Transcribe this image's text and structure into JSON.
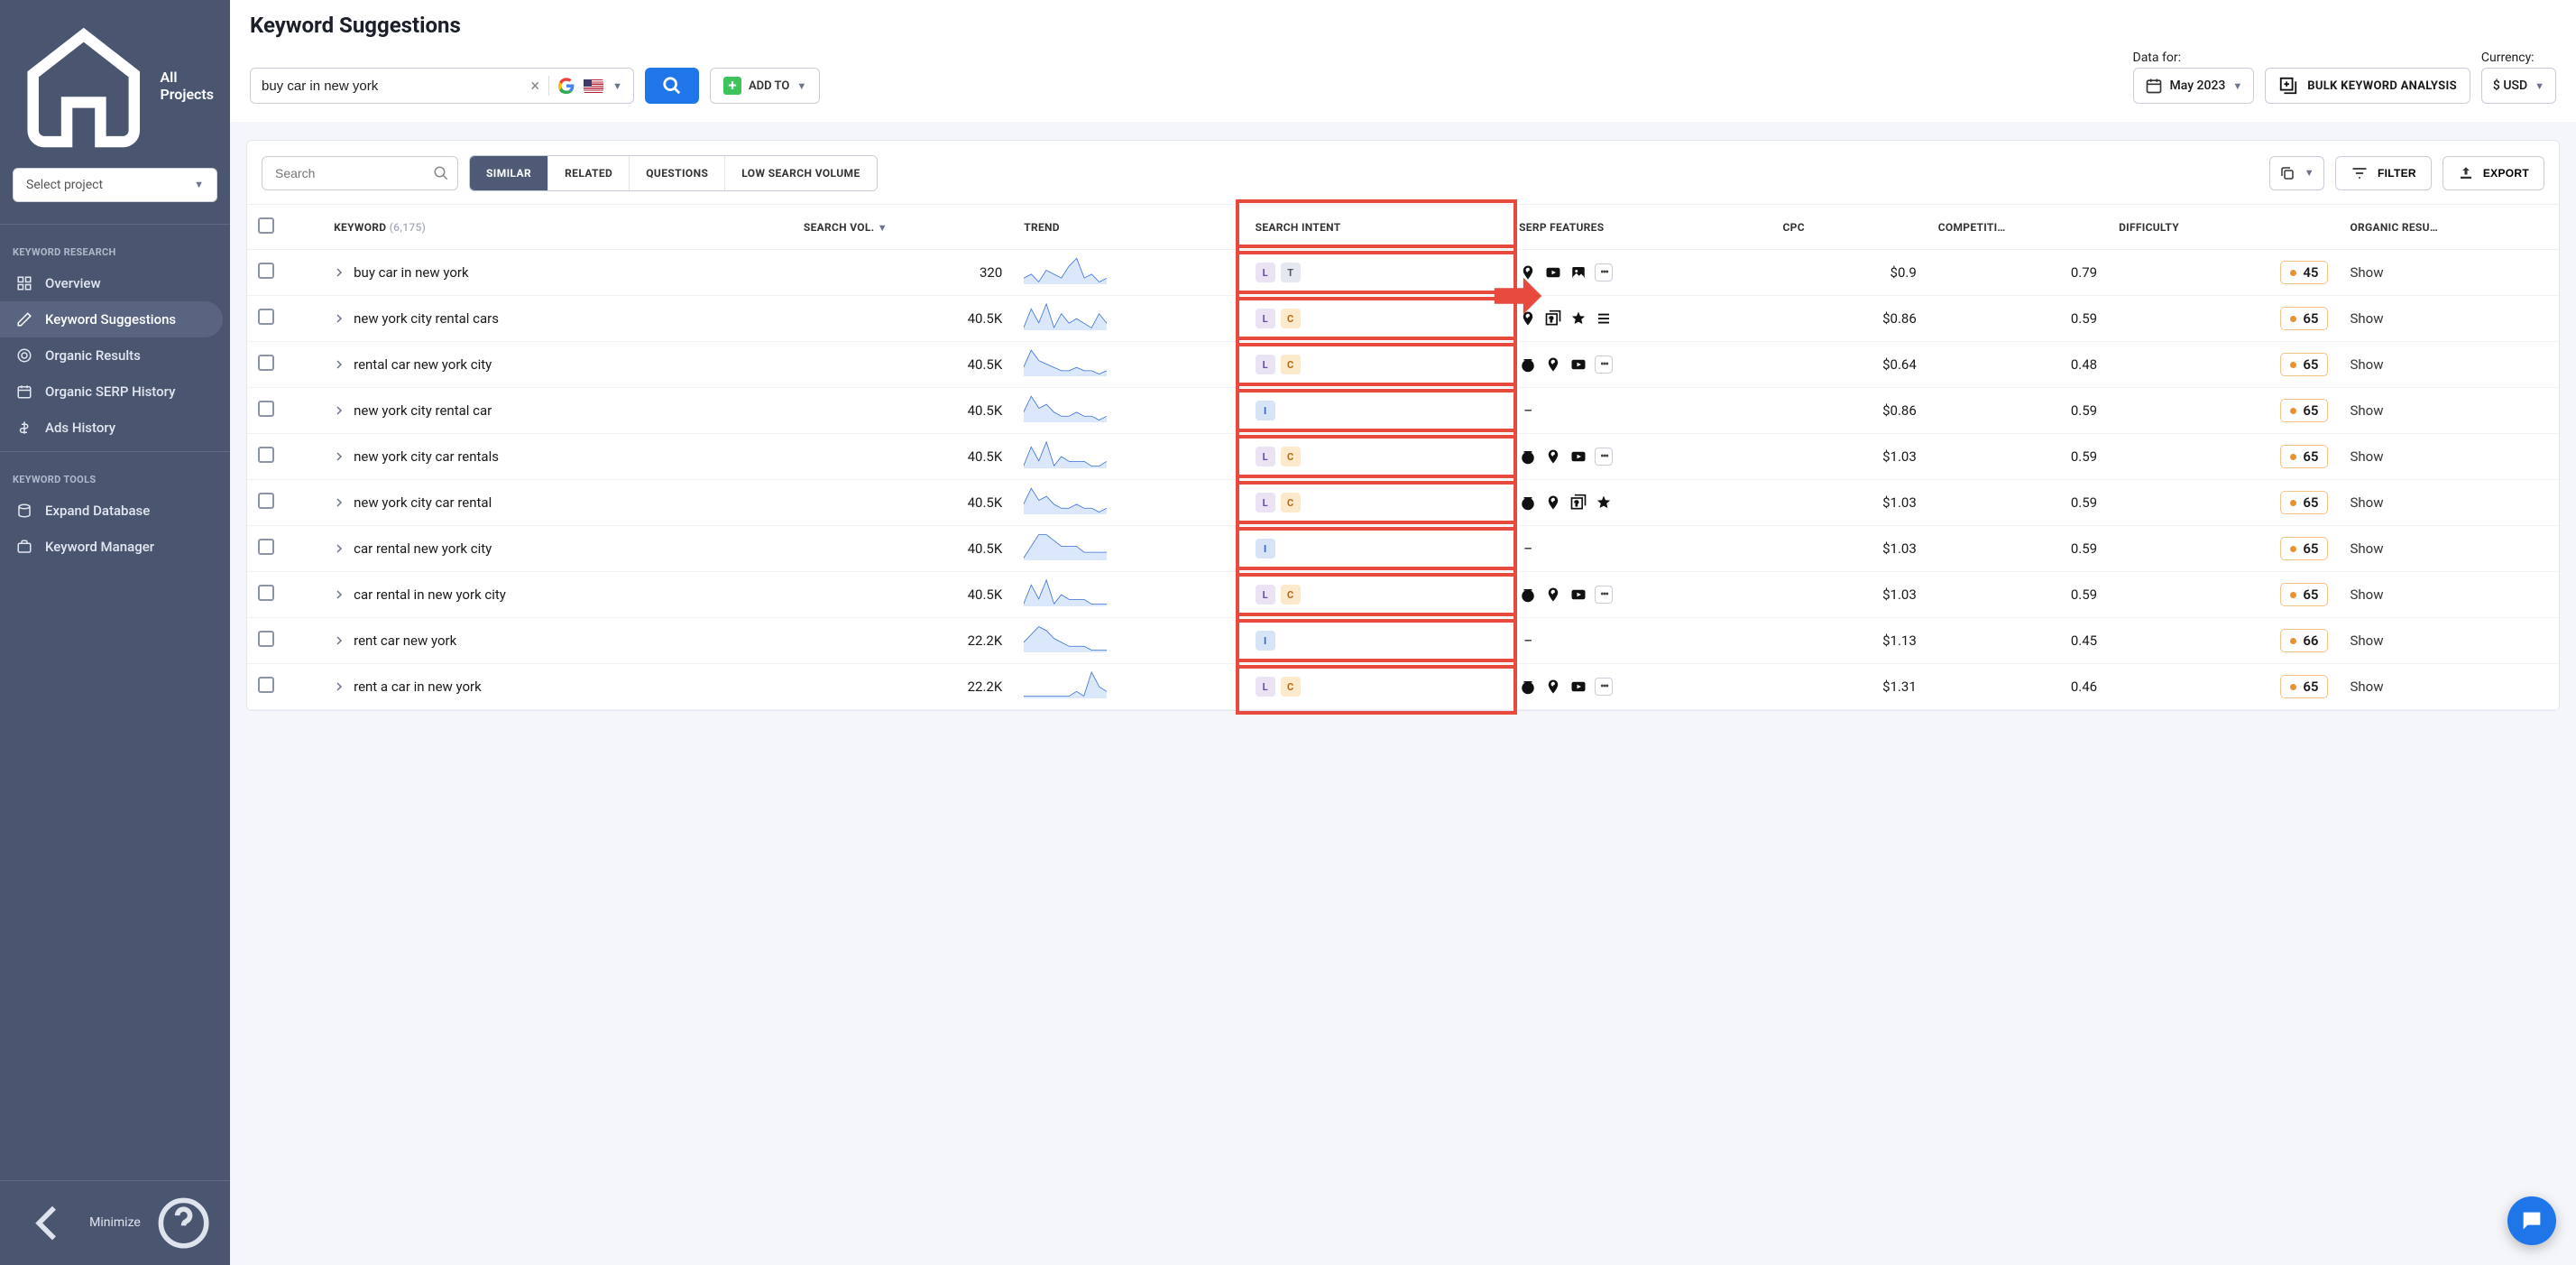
{
  "sidebar": {
    "all_projects": "All Projects",
    "select_project_placeholder": "Select project",
    "sections": {
      "research_label": "KEYWORD RESEARCH",
      "tools_label": "KEYWORD TOOLS"
    },
    "items": {
      "overview": "Overview",
      "keyword_suggestions": "Keyword Suggestions",
      "organic_results": "Organic Results",
      "organic_serp_history": "Organic SERP History",
      "ads_history": "Ads History",
      "expand_database": "Expand Database",
      "keyword_manager": "Keyword Manager"
    },
    "minimize": "Minimize"
  },
  "header": {
    "title": "Keyword Suggestions",
    "search_value": "buy car in new york",
    "add_to": "ADD TO",
    "data_for_label": "Data for:",
    "data_for_value": "May 2023",
    "bulk_analysis": "BULK KEYWORD ANALYSIS",
    "currency_label": "Currency:",
    "currency_value": "$ USD"
  },
  "toolbar": {
    "search_placeholder": "Search",
    "segments": {
      "similar": "SIMILAR",
      "related": "RELATED",
      "questions": "QUESTIONS",
      "low_volume": "LOW SEARCH VOLUME"
    },
    "filter": "FILTER",
    "export": "EXPORT"
  },
  "table": {
    "headers": {
      "keyword": "KEYWORD",
      "keyword_count": "(6,175)",
      "search_vol": "SEARCH VOL.",
      "trend": "TREND",
      "intent": "SEARCH INTENT",
      "serp": "SERP FEATURES",
      "cpc": "CPC",
      "competition": "COMPETITI…",
      "difficulty": "DIFFICULTY",
      "organic": "ORGANIC RESU…"
    },
    "rows": [
      {
        "kw": "buy car in new york",
        "vol": "320",
        "trend": [
          4,
          5,
          3,
          6,
          5,
          4,
          7,
          9,
          4,
          5,
          3,
          4
        ],
        "intents": [
          "L",
          "T"
        ],
        "serps": [
          "pin",
          "video",
          "image",
          "more"
        ],
        "cpc": "$0.9",
        "comp": "0.79",
        "diff": "45",
        "org": "Show"
      },
      {
        "kw": "new york city rental cars",
        "vol": "40.5K",
        "trend": [
          3,
          7,
          4,
          8,
          3,
          6,
          4,
          5,
          4,
          3,
          6,
          4
        ],
        "intents": [
          "L",
          "C"
        ],
        "serps": [
          "pin",
          "faq",
          "star",
          "list"
        ],
        "cpc": "$0.86",
        "comp": "0.59",
        "diff": "65",
        "org": "Show"
      },
      {
        "kw": "rental car new york city",
        "vol": "40.5K",
        "trend": [
          4,
          9,
          6,
          5,
          4,
          3,
          3,
          4,
          3,
          3,
          2,
          3
        ],
        "intents": [
          "L",
          "C"
        ],
        "serps": [
          "dollar",
          "pin",
          "video",
          "more"
        ],
        "cpc": "$0.64",
        "comp": "0.48",
        "diff": "65",
        "org": "Show"
      },
      {
        "kw": "new york city rental car",
        "vol": "40.5K",
        "trend": [
          4,
          8,
          5,
          6,
          4,
          3,
          3,
          4,
          3,
          3,
          2,
          3
        ],
        "intents": [
          "I"
        ],
        "serps": [
          "dash"
        ],
        "cpc": "$0.86",
        "comp": "0.59",
        "diff": "65",
        "org": "Show"
      },
      {
        "kw": "new york city car rentals",
        "vol": "40.5K",
        "trend": [
          3,
          7,
          4,
          8,
          3,
          5,
          4,
          4,
          4,
          3,
          3,
          4
        ],
        "intents": [
          "L",
          "C"
        ],
        "serps": [
          "dollar",
          "pin",
          "video",
          "more"
        ],
        "cpc": "$1.03",
        "comp": "0.59",
        "diff": "65",
        "org": "Show"
      },
      {
        "kw": "new york city car rental",
        "vol": "40.5K",
        "trend": [
          4,
          8,
          5,
          6,
          4,
          3,
          3,
          4,
          3,
          3,
          2,
          3
        ],
        "intents": [
          "L",
          "C"
        ],
        "serps": [
          "dollar",
          "pin",
          "faq",
          "star"
        ],
        "cpc": "$1.03",
        "comp": "0.59",
        "diff": "65",
        "org": "Show"
      },
      {
        "kw": "car rental new york city",
        "vol": "40.5K",
        "trend": [
          2,
          4,
          6,
          6,
          5,
          4,
          4,
          4,
          3,
          3,
          3,
          3
        ],
        "intents": [
          "I"
        ],
        "serps": [
          "dash"
        ],
        "cpc": "$1.03",
        "comp": "0.59",
        "diff": "65",
        "org": "Show"
      },
      {
        "kw": "car rental in new york city",
        "vol": "40.5K",
        "trend": [
          3,
          7,
          4,
          8,
          3,
          5,
          4,
          4,
          4,
          3,
          3,
          3
        ],
        "intents": [
          "L",
          "C"
        ],
        "serps": [
          "dollar",
          "pin",
          "video",
          "more"
        ],
        "cpc": "$1.03",
        "comp": "0.59",
        "diff": "65",
        "org": "Show"
      },
      {
        "kw": "rent car new york",
        "vol": "22.2K",
        "trend": [
          4,
          6,
          8,
          7,
          5,
          4,
          3,
          3,
          3,
          2,
          2,
          2
        ],
        "intents": [
          "I"
        ],
        "serps": [
          "dash"
        ],
        "cpc": "$1.13",
        "comp": "0.45",
        "diff": "66",
        "org": "Show"
      },
      {
        "kw": "rent a car in new york",
        "vol": "22.2K",
        "trend": [
          3,
          3,
          3,
          3,
          3,
          3,
          3,
          4,
          3,
          8,
          5,
          4
        ],
        "intents": [
          "L",
          "C"
        ],
        "serps": [
          "dollar",
          "pin",
          "video",
          "more"
        ],
        "cpc": "$1.31",
        "comp": "0.46",
        "diff": "65",
        "org": "Show"
      }
    ]
  }
}
